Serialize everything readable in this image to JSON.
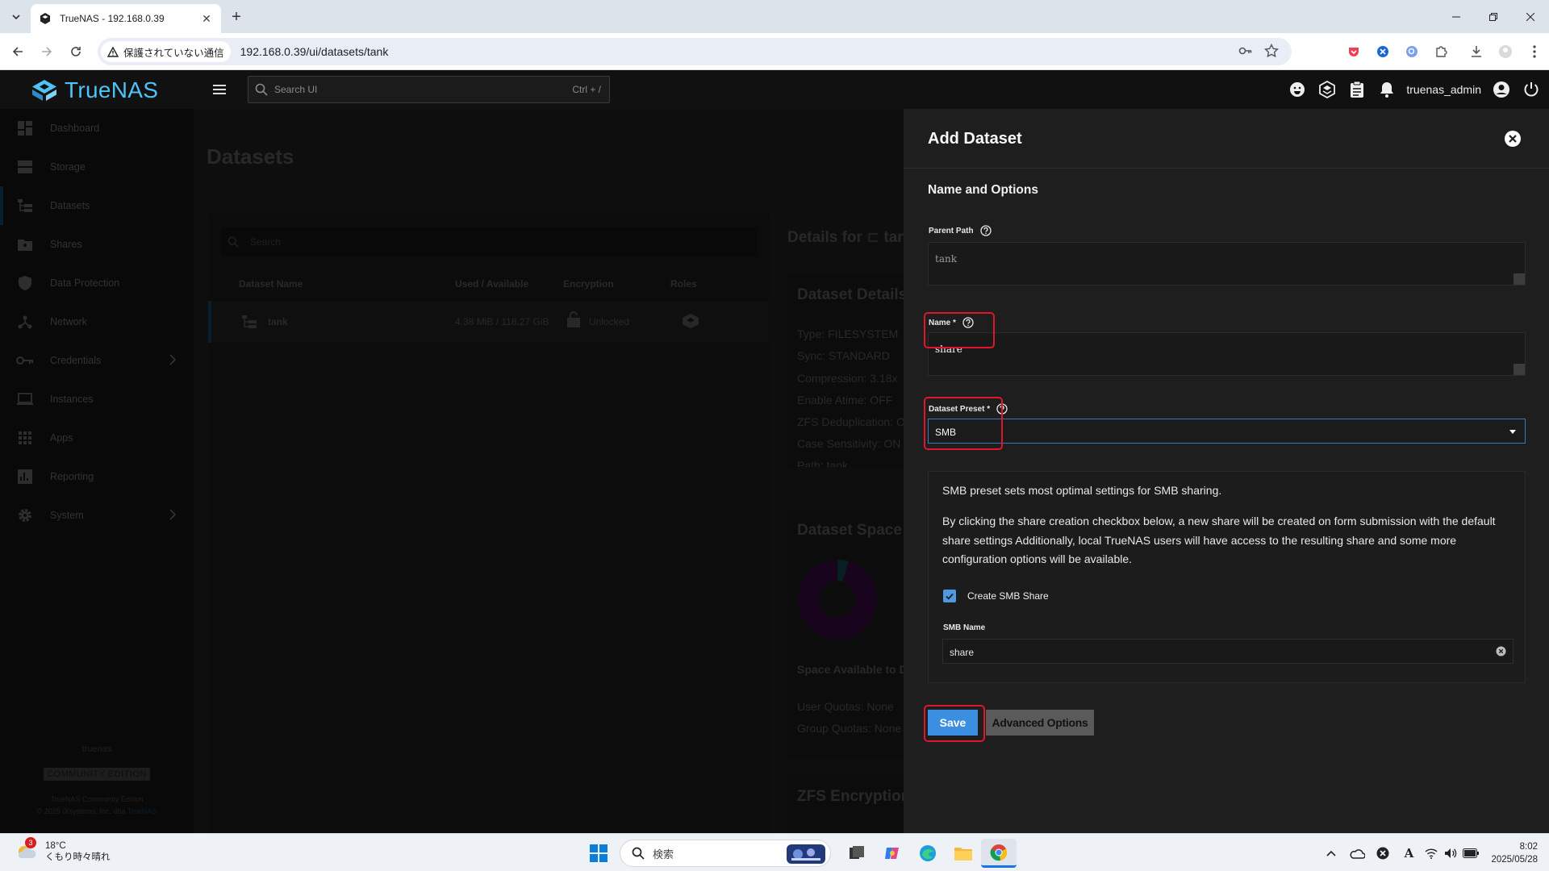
{
  "browser": {
    "tab_title": "TrueNAS - 192.168.0.39",
    "security_label": "保護されていない通信",
    "url": "192.168.0.39/ui/datasets/tank"
  },
  "app": {
    "logo_text": "TrueNAS",
    "search_placeholder": "Search UI",
    "search_shortcut": "Ctrl + /",
    "username": "truenas_admin"
  },
  "sidebar": {
    "items": [
      {
        "label": "Dashboard",
        "icon": "dashboard-icon"
      },
      {
        "label": "Storage",
        "icon": "storage-icon"
      },
      {
        "label": "Datasets",
        "icon": "datasets-icon"
      },
      {
        "label": "Shares",
        "icon": "shares-icon"
      },
      {
        "label": "Data Protection",
        "icon": "shield-icon"
      },
      {
        "label": "Network",
        "icon": "network-icon"
      },
      {
        "label": "Credentials",
        "icon": "key-icon"
      },
      {
        "label": "Instances",
        "icon": "laptop-icon"
      },
      {
        "label": "Apps",
        "icon": "apps-grid-icon"
      },
      {
        "label": "Reporting",
        "icon": "chart-icon"
      },
      {
        "label": "System",
        "icon": "gear-icon"
      }
    ],
    "hostname": "truenas",
    "edition_badge": "COMMUNITY EDITION",
    "edition_text": "TrueNAS Community Edition",
    "copyright": "© 2025 iXsystems, Inc. dba",
    "copyright_link": "TrueNAS"
  },
  "main": {
    "page_title": "Datasets",
    "search_placeholder": "Search",
    "columns": {
      "name": "Dataset Name",
      "used": "Used / Available",
      "encryption": "Encryption",
      "roles": "Roles"
    },
    "row": {
      "name": "tank",
      "used": "4.38 MiB / 118.27 GiB",
      "encryption": "Unlocked"
    },
    "details_title": "Details for",
    "details_path": "tank",
    "details_card": {
      "title": "Dataset Details",
      "type": "Type: FILESYSTEM",
      "sync": "Sync: STANDARD",
      "compression": "Compression: 3.18x",
      "atime": "Enable Atime: OFF",
      "dedup": "ZFS Deduplication: OFF",
      "case": "Case Sensitivity: ON",
      "path": "Path: tank"
    },
    "space_card": {
      "title": "Dataset Space Management",
      "available": "Space Available to Dataset",
      "user_quotas": "User Quotas: None",
      "group_quotas": "Group Quotas: None"
    },
    "encryption_card": {
      "title": "ZFS Encryption"
    }
  },
  "drawer": {
    "title": "Add Dataset",
    "section": "Name and Options",
    "parent_path_label": "Parent Path",
    "parent_path_value": "tank",
    "name_label": "Name",
    "name_value": "share",
    "preset_label": "Dataset Preset",
    "preset_value": "SMB",
    "info_1": "SMB preset sets most optimal settings for SMB sharing.",
    "info_2": "By clicking the share creation checkbox below, a new share will be created on form submission with the default share settings Additionally, local TrueNAS users will have access to the resulting share and some more configuration options will be available.",
    "create_share_label": "Create SMB Share",
    "create_share_checked": true,
    "smb_name_label": "SMB Name",
    "smb_name_value": "share",
    "save_label": "Save",
    "advanced_label": "Advanced Options",
    "required_mark": "*"
  },
  "taskbar": {
    "weather_badge": "3",
    "temperature": "18°C",
    "weather_text": "くもり時々晴れ",
    "search_placeholder": "検索",
    "time": "8:02",
    "date": "2025/05/28"
  },
  "colors": {
    "accent": "#3b8ee0",
    "logo": "#4fc3f7",
    "highlight": "#e0162b"
  }
}
